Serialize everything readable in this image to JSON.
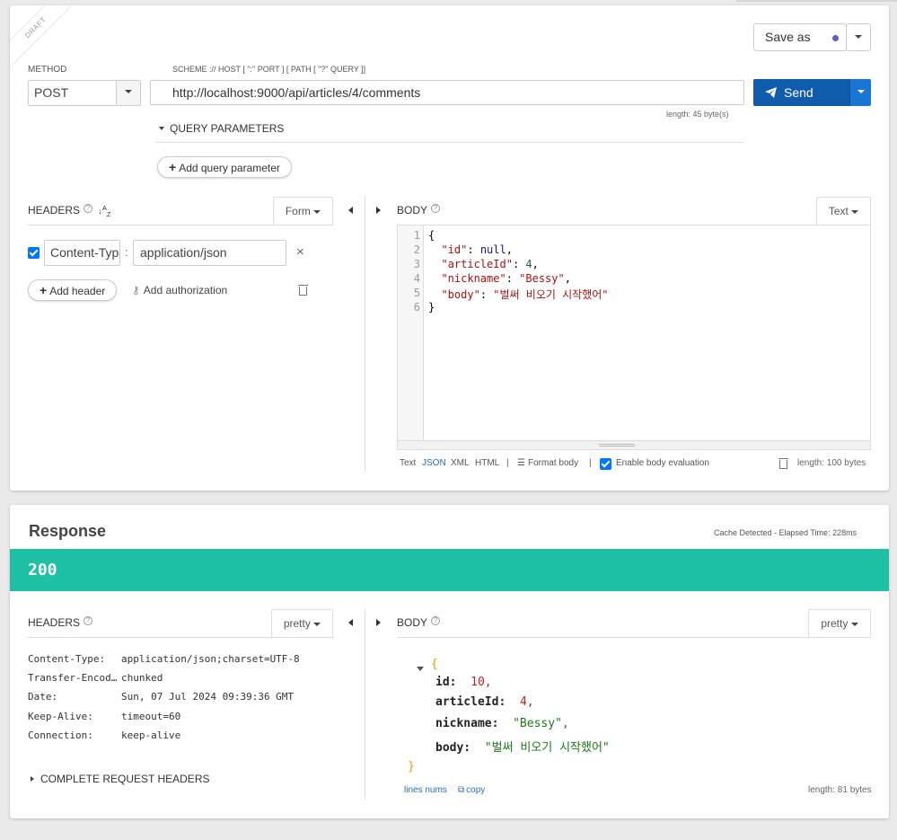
{
  "request": {
    "draft_label": "DRAFT",
    "save_as_label": "Save as",
    "method_label": "METHOD",
    "method_value": "POST",
    "scheme_label": "SCHEME :// HOST [ \":\" PORT ] [ PATH [ \"?\" QUERY ]]",
    "url": "http://localhost:9000/api/articles/4/comments",
    "url_length": "length: 45 byte(s)",
    "send_label": "Send",
    "query_params_label": "QUERY PARAMETERS",
    "add_query_param_label": "Add query parameter",
    "headers_title": "HEADERS",
    "headers_mode": "Form",
    "header_key": "Content-Type",
    "header_value": "application/json",
    "header_separator": ":",
    "add_header_label": "Add header",
    "add_authorization_label": "Add authorization",
    "body_title": "BODY",
    "body_mode": "Text",
    "body_lines": [
      {
        "no": "1",
        "text": "{"
      },
      {
        "no": "2",
        "key": "\"id\"",
        "val": "null"
      },
      {
        "no": "3",
        "key": "\"articleId\"",
        "val": "4"
      },
      {
        "no": "4",
        "key": "\"nickname\"",
        "val": "\"Bessy\""
      },
      {
        "no": "5",
        "key": "\"body\"",
        "val": "\"벌써 비오기 시작했어\""
      },
      {
        "no": "6",
        "text": "}"
      }
    ],
    "body_formats": [
      "Text",
      "JSON",
      "XML",
      "HTML"
    ],
    "format_body_label": "Format body",
    "enable_eval_label": "Enable body evaluation",
    "body_length": "length: 100 bytes"
  },
  "response": {
    "title": "Response",
    "cache_info": "Cache Detected - Elapsed Time: 228ms",
    "status_code": "200",
    "status_color": "#1ec1a4",
    "headers_title": "HEADERS",
    "headers_mode": "pretty",
    "headers": [
      {
        "name": "Content-Type:",
        "value": "application/json;charset=UTF-8"
      },
      {
        "name": "Transfer-Encod…",
        "value": "chunked"
      },
      {
        "name": "Date:",
        "value": "Sun, 07 Jul 2024 09:39:36 GMT"
      },
      {
        "name": "Keep-Alive:",
        "value": "timeout=60"
      },
      {
        "name": "Connection:",
        "value": "keep-alive"
      }
    ],
    "complete_headers_label": "COMPLETE REQUEST HEADERS",
    "body_title": "BODY",
    "body_mode": "pretty",
    "body_fields": [
      {
        "key": "id:",
        "value": "10,",
        "type": "num"
      },
      {
        "key": "articleId:",
        "value": "4,",
        "type": "num"
      },
      {
        "key": "nickname:",
        "value": "\"Bessy\",",
        "type": "str"
      },
      {
        "key": "body:",
        "value": "\"벌써 비오기 시작했어\"",
        "type": "str"
      }
    ],
    "open_brace": "{",
    "close_brace": "}",
    "line_nums_label": "lines nums",
    "copy_label": "copy",
    "body_length": "length: 81 bytes"
  },
  "colors": {
    "send_button": "#0f5cac",
    "status_bar": "#1ec1a4",
    "link": "#2a6ebb"
  }
}
